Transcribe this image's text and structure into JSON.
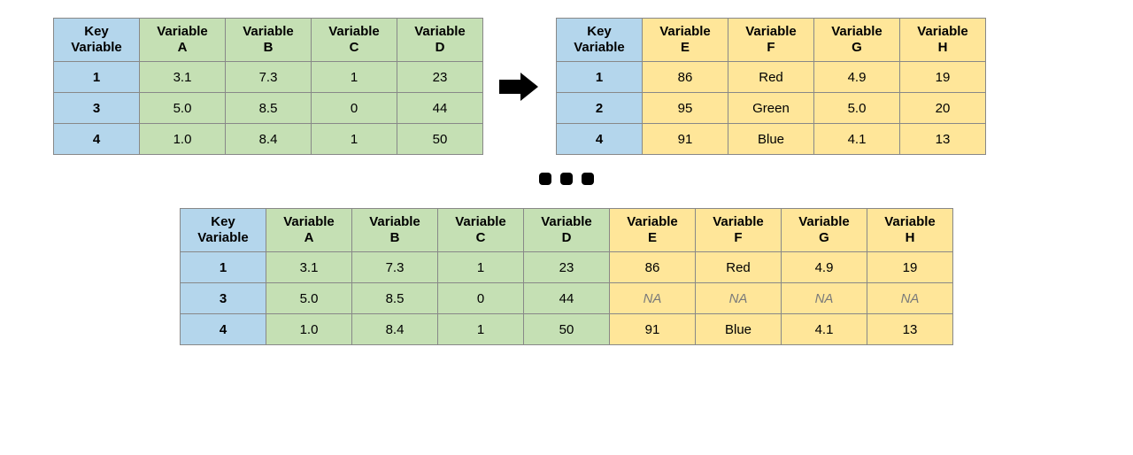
{
  "headers": {
    "key": "Key Variable",
    "A": "Variable A",
    "B": "Variable B",
    "C": "Variable C",
    "D": "Variable D",
    "E": "Variable E",
    "F": "Variable F",
    "G": "Variable G",
    "H": "Variable H"
  },
  "left_table": {
    "keys": [
      "1",
      "3",
      "4"
    ],
    "A": [
      "3.1",
      "5.0",
      "1.0"
    ],
    "B": [
      "7.3",
      "8.5",
      "8.4"
    ],
    "C": [
      "1",
      "0",
      "1"
    ],
    "D": [
      "23",
      "44",
      "50"
    ]
  },
  "right_table": {
    "keys": [
      "1",
      "2",
      "4"
    ],
    "E": [
      "86",
      "95",
      "91"
    ],
    "F": [
      "Red",
      "Green",
      "Blue"
    ],
    "G": [
      "4.9",
      "5.0",
      "4.1"
    ],
    "H": [
      "19",
      "20",
      "13"
    ]
  },
  "joined_table": {
    "keys": [
      "1",
      "3",
      "4"
    ],
    "A": [
      "3.1",
      "5.0",
      "1.0"
    ],
    "B": [
      "7.3",
      "8.5",
      "8.4"
    ],
    "C": [
      "1",
      "0",
      "1"
    ],
    "D": [
      "23",
      "44",
      "50"
    ],
    "E": [
      "86",
      "NA",
      "91"
    ],
    "F": [
      "Red",
      "NA",
      "Blue"
    ],
    "G": [
      "4.9",
      "NA",
      "4.1"
    ],
    "H": [
      "19",
      "NA",
      "13"
    ]
  },
  "na_token": "NA",
  "chart_data": {
    "type": "table",
    "description": "Left-join diagram: left table (keys 1,3,4 with Variables A–D) joined to right table (keys 1,2,4 with Variables E–H) on Key Variable, producing a joined table where key 3 has NA for E–H.",
    "left": {
      "columns": [
        "Key Variable",
        "Variable A",
        "Variable B",
        "Variable C",
        "Variable D"
      ],
      "rows": [
        [
          1,
          3.1,
          7.3,
          1,
          23
        ],
        [
          3,
          5.0,
          8.5,
          0,
          44
        ],
        [
          4,
          1.0,
          8.4,
          1,
          50
        ]
      ]
    },
    "right": {
      "columns": [
        "Key Variable",
        "Variable E",
        "Variable F",
        "Variable G",
        "Variable H"
      ],
      "rows": [
        [
          1,
          86,
          "Red",
          4.9,
          19
        ],
        [
          2,
          95,
          "Green",
          5.0,
          20
        ],
        [
          4,
          91,
          "Blue",
          4.1,
          13
        ]
      ]
    },
    "joined": {
      "columns": [
        "Key Variable",
        "Variable A",
        "Variable B",
        "Variable C",
        "Variable D",
        "Variable E",
        "Variable F",
        "Variable G",
        "Variable H"
      ],
      "rows": [
        [
          1,
          3.1,
          7.3,
          1,
          23,
          86,
          "Red",
          4.9,
          19
        ],
        [
          3,
          5.0,
          8.5,
          0,
          44,
          null,
          null,
          null,
          null
        ],
        [
          4,
          1.0,
          8.4,
          1,
          50,
          91,
          "Blue",
          4.1,
          13
        ]
      ]
    }
  }
}
